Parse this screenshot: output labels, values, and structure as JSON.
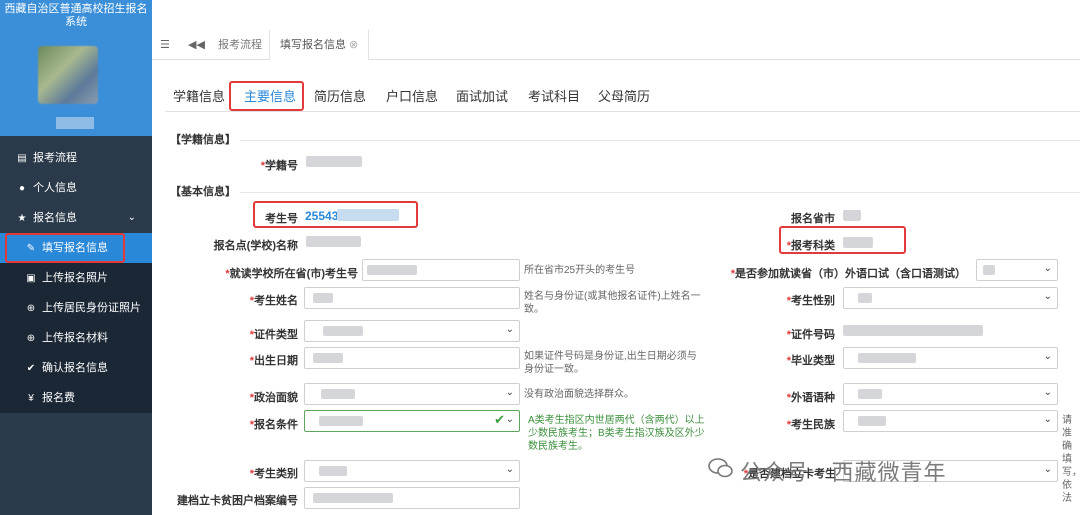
{
  "sidebar": {
    "system_title": "西藏自治区普通高校招生报名系统",
    "menu": [
      {
        "label": "报考流程",
        "icon": "list-icon"
      },
      {
        "label": "个人信息",
        "icon": "user-icon"
      },
      {
        "label": "报名信息",
        "icon": "star-icon"
      }
    ],
    "submenu": [
      {
        "label": "填写报名信息",
        "icon": "edit-icon"
      },
      {
        "label": "上传报名照片",
        "icon": "image-file-icon"
      },
      {
        "label": "上传居民身份证照片",
        "icon": "plus-circle-icon"
      },
      {
        "label": "上传报名材料",
        "icon": "plus-circle-icon"
      },
      {
        "label": "确认报名信息",
        "icon": "check-icon"
      },
      {
        "label": "报名费",
        "icon": "yen-icon"
      }
    ]
  },
  "topbar": {
    "tabs": [
      {
        "label": "报考流程"
      },
      {
        "label": "填写报名信息"
      }
    ]
  },
  "content_tabs": [
    "学籍信息",
    "主要信息",
    "简历信息",
    "户口信息",
    "面试加试",
    "考试科目",
    "父母简历"
  ],
  "sections": {
    "xueji": "【学籍信息】",
    "jiben": "【基本信息】"
  },
  "fields": {
    "xuejihao": "学籍号",
    "kaoshenghao": "考生号",
    "kaoshenghao_value": "25543",
    "baomingdian": "报名点(学校)名称",
    "jiudu": "就读学校所在省(市)考生号",
    "jiudu_hint": "所在省市25开头的考生号",
    "xingming": "考生姓名",
    "xingming_hint": "姓名与身份证(或其他报名证件)上姓名一致。",
    "zhengjian_leixing": "证件类型",
    "chusheng": "出生日期",
    "chusheng_hint": "如果证件号码是身份证,出生日期必须与身份证一致。",
    "zhengzhi": "政治面貌",
    "zhengzhi_hint": "没有政治面貌选择群众。",
    "tiaojian": "报名条件",
    "tiaojian_hint": "A类考生指区内世居两代（含两代）以上少数民族考生；B类考生指汉族及区外少数民族考生。",
    "leibie": "考生类别",
    "jiandang": "建档立卡贫困户档案编号",
    "shengshi": "报名省市",
    "kelei": "报考科类",
    "waiyu": "是否参加就读省（市）外语口试（含口语测试）",
    "xingbie": "考生性别",
    "zhengjian_haoma": "证件号码",
    "biye": "毕业类型",
    "waiyu_yuzhong": "外语语种",
    "minzu": "考生民族",
    "minzu_hint": "请准确填写，依法",
    "jiandang_kaosheng": "是否建档立卡考生"
  },
  "watermark": "公众号 · 西藏微青年"
}
